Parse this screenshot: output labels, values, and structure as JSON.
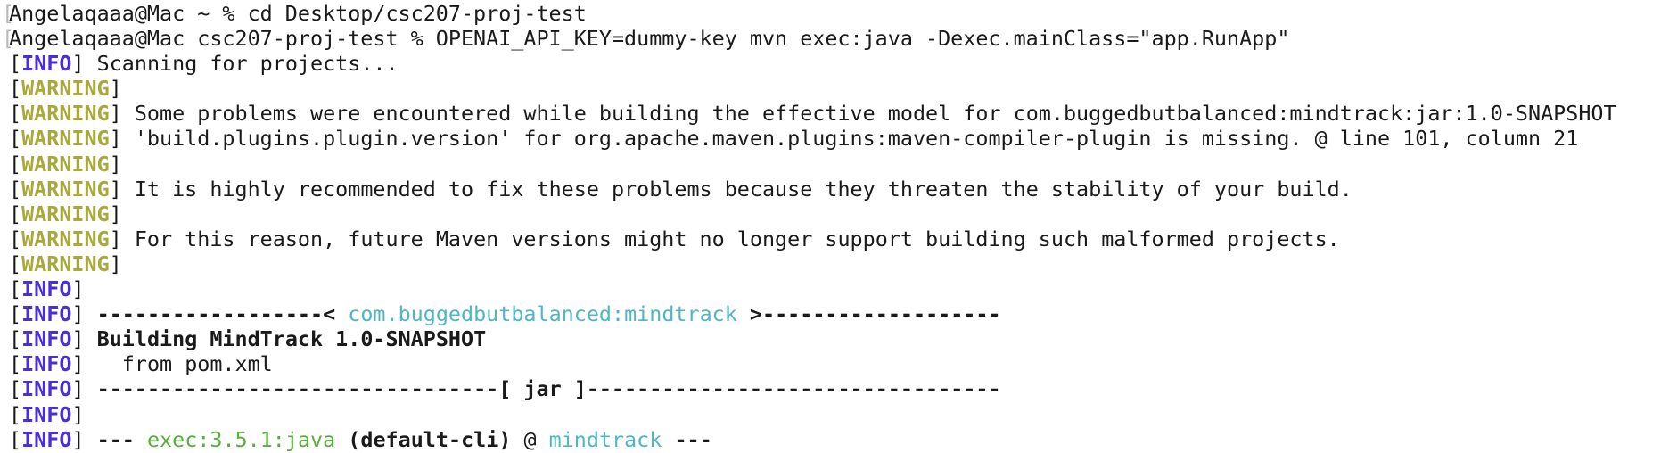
{
  "colors": {
    "info": "#4a2fd8",
    "warning": "#a9a83c",
    "cyan": "#4fb6c6",
    "green": "#58b03b",
    "text": "#1a1a1a",
    "mark": "#b8b8b8"
  },
  "prompts": [
    {
      "text": "Angelaqaaa@Mac ~ % cd Desktop/csc207-proj-test"
    },
    {
      "text": "Angelaqaaa@Mac csc207-proj-test % OPENAI_API_KEY=dummy-key mvn exec:java -Dexec.mainClass=\"app.RunApp\""
    }
  ],
  "lines": [
    {
      "level": "INFO",
      "segments": [
        {
          "t": " Scanning for projects...",
          "s": "n"
        }
      ]
    },
    {
      "level": "WARNING",
      "segments": []
    },
    {
      "level": "WARNING",
      "segments": [
        {
          "t": " Some problems were encountered while building the effective model for com.buggedbutbalanced:mindtrack:jar:1.0-SNAPSHOT",
          "s": "n"
        }
      ]
    },
    {
      "level": "WARNING",
      "segments": [
        {
          "t": " 'build.plugins.plugin.version' for org.apache.maven.plugins:maven-compiler-plugin is missing. @ line 101, column 21",
          "s": "n"
        }
      ]
    },
    {
      "level": "WARNING",
      "segments": []
    },
    {
      "level": "WARNING",
      "segments": [
        {
          "t": " It is highly recommended to fix these problems because they threaten the stability of your build.",
          "s": "n"
        }
      ]
    },
    {
      "level": "WARNING",
      "segments": []
    },
    {
      "level": "WARNING",
      "segments": [
        {
          "t": " For this reason, future Maven versions might no longer support building such malformed projects.",
          "s": "n"
        }
      ]
    },
    {
      "level": "WARNING",
      "segments": []
    },
    {
      "level": "INFO",
      "segments": []
    },
    {
      "level": "INFO",
      "segments": [
        {
          "t": " ------------------< ",
          "s": "b"
        },
        {
          "t": "com.buggedbutbalanced:mindtrack",
          "s": "cyan"
        },
        {
          "t": " >-------------------",
          "s": "b"
        }
      ]
    },
    {
      "level": "INFO",
      "segments": [
        {
          "t": " Building MindTrack 1.0-SNAPSHOT",
          "s": "b"
        }
      ]
    },
    {
      "level": "INFO",
      "segments": [
        {
          "t": "   from pom.xml",
          "s": "n"
        }
      ]
    },
    {
      "level": "INFO",
      "segments": [
        {
          "t": " --------------------------------[ jar ]---------------------------------",
          "s": "b"
        }
      ]
    },
    {
      "level": "INFO",
      "segments": []
    },
    {
      "level": "INFO",
      "segments": [
        {
          "t": " --- ",
          "s": "b"
        },
        {
          "t": "exec:3.5.1:java",
          "s": "green"
        },
        {
          "t": " (default-cli)",
          "s": "b"
        },
        {
          "t": " @ ",
          "s": "n"
        },
        {
          "t": "mindtrack",
          "s": "cyan"
        },
        {
          "t": " ---",
          "s": "b"
        }
      ]
    }
  ]
}
